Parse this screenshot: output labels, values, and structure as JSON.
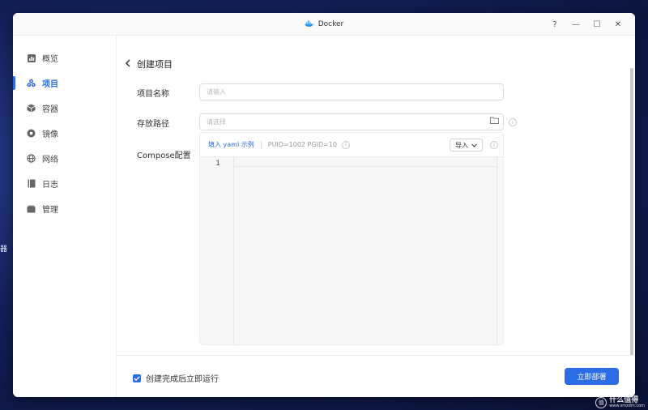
{
  "desktop": {
    "edge_glyph": "器"
  },
  "window": {
    "title": "Docker",
    "controls": {
      "help": "?",
      "minimize": "—",
      "maximize": "☐",
      "close": "✕"
    }
  },
  "sidebar": {
    "items": [
      {
        "label": "概览",
        "icon": "chart-icon",
        "active": false
      },
      {
        "label": "项目",
        "icon": "project-icon",
        "active": true
      },
      {
        "label": "容器",
        "icon": "container-icon",
        "active": false
      },
      {
        "label": "镜像",
        "icon": "image-disc-icon",
        "active": false
      },
      {
        "label": "网络",
        "icon": "globe-icon",
        "active": false
      },
      {
        "label": "日志",
        "icon": "log-book-icon",
        "active": false
      },
      {
        "label": "管理",
        "icon": "management-icon",
        "active": false
      }
    ]
  },
  "page": {
    "back_title": "创建项目",
    "project_name": {
      "label": "项目名称",
      "placeholder": "请输入",
      "value": ""
    },
    "storage_path": {
      "label": "存放路径",
      "placeholder": "请选择",
      "value": ""
    },
    "compose": {
      "label": "Compose配置",
      "fill_example": "填入 yaml 示例",
      "puid_text": "PUID=1002 PGID=10",
      "import_label": "导入",
      "line_number": "1"
    }
  },
  "footer": {
    "checkbox_label": "创建完成后立即运行",
    "checked": true,
    "deploy_label": "立即部署"
  },
  "watermark": {
    "name": "什么值得",
    "url": "www.smzdm.com"
  },
  "colors": {
    "accent": "#2b6de5",
    "desktop": "#13205a"
  }
}
